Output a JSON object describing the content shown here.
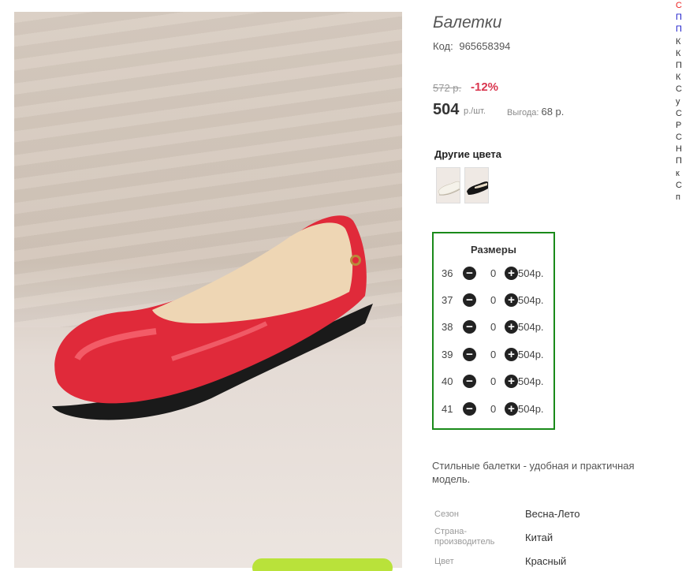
{
  "product": {
    "title": "Балетки",
    "code_label": "Код:",
    "code_value": "965658394",
    "old_price": "572 р.",
    "discount": "-12%",
    "price": "504",
    "unit": "р./шт.",
    "savings_label": "Выгода:",
    "savings_value": "68 р."
  },
  "colors": {
    "title": "Другие цвета",
    "items": [
      {
        "icon": "white-ballet-flat"
      },
      {
        "icon": "black-ballet-flat"
      }
    ]
  },
  "sizes": {
    "title": "Размеры",
    "rows": [
      {
        "size": "36",
        "qty": "0",
        "price": "504р."
      },
      {
        "size": "37",
        "qty": "0",
        "price": "504р."
      },
      {
        "size": "38",
        "qty": "0",
        "price": "504р."
      },
      {
        "size": "39",
        "qty": "0",
        "price": "504р."
      },
      {
        "size": "40",
        "qty": "0",
        "price": "504р."
      },
      {
        "size": "41",
        "qty": "0",
        "price": "504р."
      }
    ],
    "minus_glyph": "−",
    "plus_glyph": "+"
  },
  "description": "Стильные балетки - удобная и практичная модель.",
  "specs": [
    {
      "label": "Сезон",
      "value": "Весна-Лето"
    },
    {
      "label": "Страна-производитель",
      "value": "Китай"
    },
    {
      "label": "Цвет",
      "value": "Красный"
    }
  ],
  "sidebar_letters": [
    "С",
    "П",
    "П",
    "К",
    "К",
    "П",
    "К",
    "С",
    "у",
    "С",
    "Р",
    "С",
    "Н",
    "П",
    "к",
    "С",
    "п"
  ],
  "colors_theme": {
    "accent_red": "#d9364f",
    "border_green": "#1a8a1a",
    "cta_green": "#b9e23a",
    "shoe_red": "#e02a3a"
  }
}
